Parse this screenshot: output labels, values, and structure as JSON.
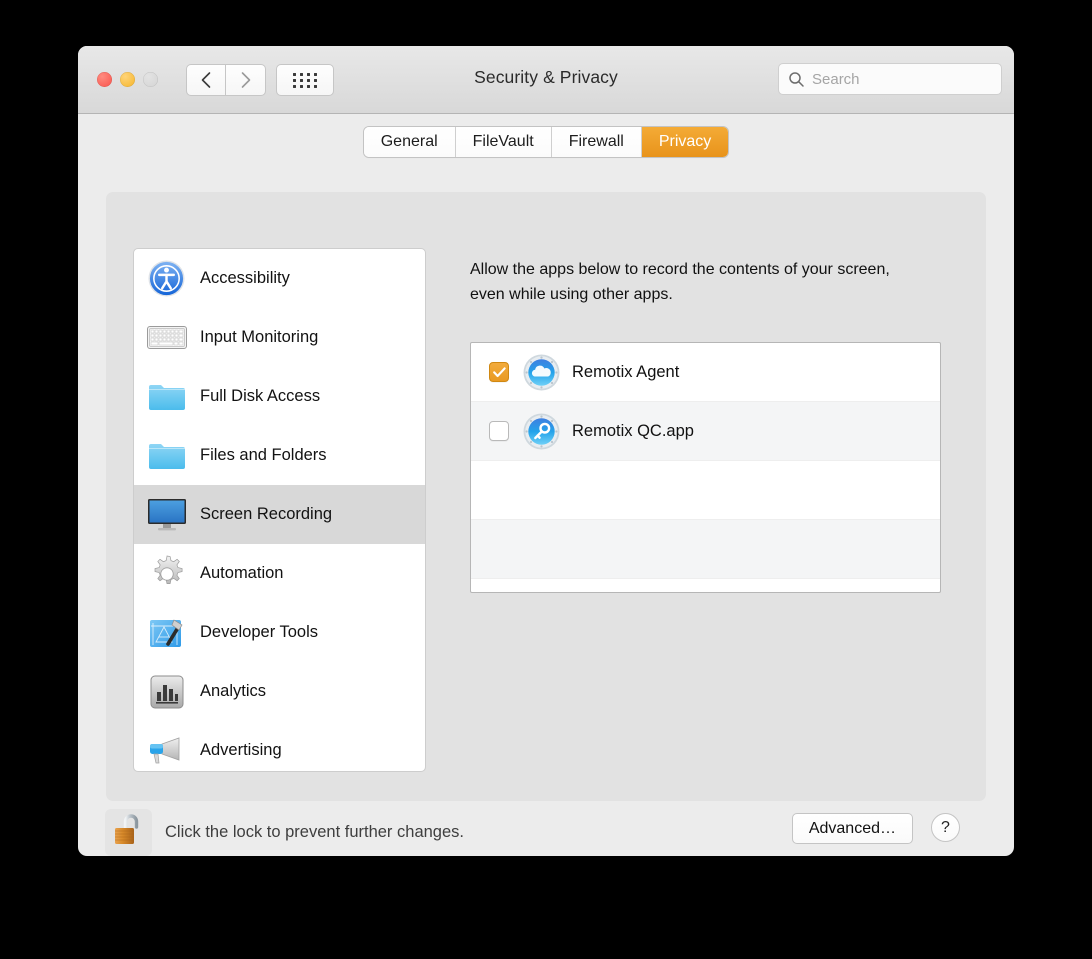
{
  "window": {
    "title": "Security & Privacy",
    "traffic_lights": [
      {
        "name": "close",
        "color": "#f9524a",
        "enabled": true
      },
      {
        "name": "minimize",
        "color": "#f5b429",
        "enabled": true
      },
      {
        "name": "zoom",
        "color": "#d4d4d4",
        "enabled": false
      }
    ],
    "nav": {
      "back_icon": "chevron-left-icon",
      "forward_icon": "chevron-right-icon",
      "show_all_icon": "grid-dots-icon"
    }
  },
  "search": {
    "icon": "search-icon",
    "value": "",
    "placeholder": "Search"
  },
  "tabs": [
    {
      "label": "General",
      "active": false
    },
    {
      "label": "FileVault",
      "active": false
    },
    {
      "label": "Firewall",
      "active": false
    },
    {
      "label": "Privacy",
      "active": true
    }
  ],
  "accent_color": "#e8931b",
  "sidebar": {
    "items": [
      {
        "label": "Accessibility",
        "icon": "accessibility-icon",
        "selected": false
      },
      {
        "label": "Input Monitoring",
        "icon": "keyboard-icon",
        "selected": false
      },
      {
        "label": "Full Disk Access",
        "icon": "folder-icon",
        "selected": false
      },
      {
        "label": "Files and Folders",
        "icon": "folder-icon",
        "selected": false
      },
      {
        "label": "Screen Recording",
        "icon": "display-icon",
        "selected": true
      },
      {
        "label": "Automation",
        "icon": "gear-icon",
        "selected": false
      },
      {
        "label": "Developer Tools",
        "icon": "hammer-blueprint-icon",
        "selected": false
      },
      {
        "label": "Analytics",
        "icon": "bar-chart-icon",
        "selected": false
      },
      {
        "label": "Advertising",
        "icon": "megaphone-icon",
        "selected": false
      }
    ]
  },
  "pane": {
    "description": "Allow the apps below to record the contents of your screen, even while using other apps.",
    "apps": [
      {
        "label": "Remotix Agent",
        "icon": "cloud-porthole-icon",
        "checked": true
      },
      {
        "label": "Remotix QC.app",
        "icon": "key-porthole-icon",
        "checked": false
      }
    ]
  },
  "footer": {
    "lock_icon": "unlocked-padlock-icon",
    "lock_text": "Click the lock to prevent further changes.",
    "advanced_label": "Advanced…",
    "help_label": "?"
  }
}
